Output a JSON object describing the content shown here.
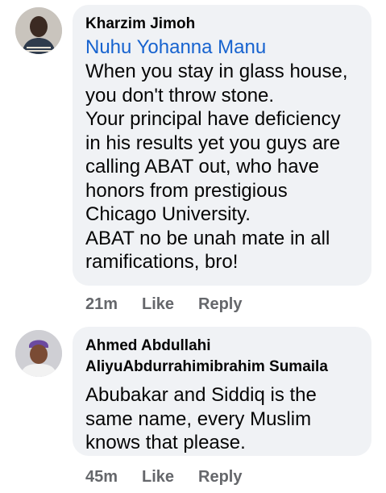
{
  "comments": [
    {
      "author": "Kharzim Jimoh",
      "mention": "Nuhu Yohanna Manu",
      "text": "When you stay in glass house,\nyou don't throw stone.\nYour principal have deficiency\nin his results yet you guys are\ncalling ABAT out, who have\nhonors from prestigious\nChicago University.\nABAT no be unah mate in all\nramifications, bro!",
      "time": "21m",
      "like_label": "Like",
      "reply_label": "Reply"
    },
    {
      "author": "Ahmed Abdullahi",
      "mention": "AliyuAbdurrahimibrahim Sumaila",
      "text": "Abubakar and Siddiq is the\nsame name, every Muslim\nknows that please.",
      "time": "45m",
      "like_label": "Like",
      "reply_label": "Reply"
    }
  ],
  "colors": {
    "bubble": "#f0f2f5",
    "mention_link": "#1763cf",
    "meta_text": "#65676b"
  }
}
